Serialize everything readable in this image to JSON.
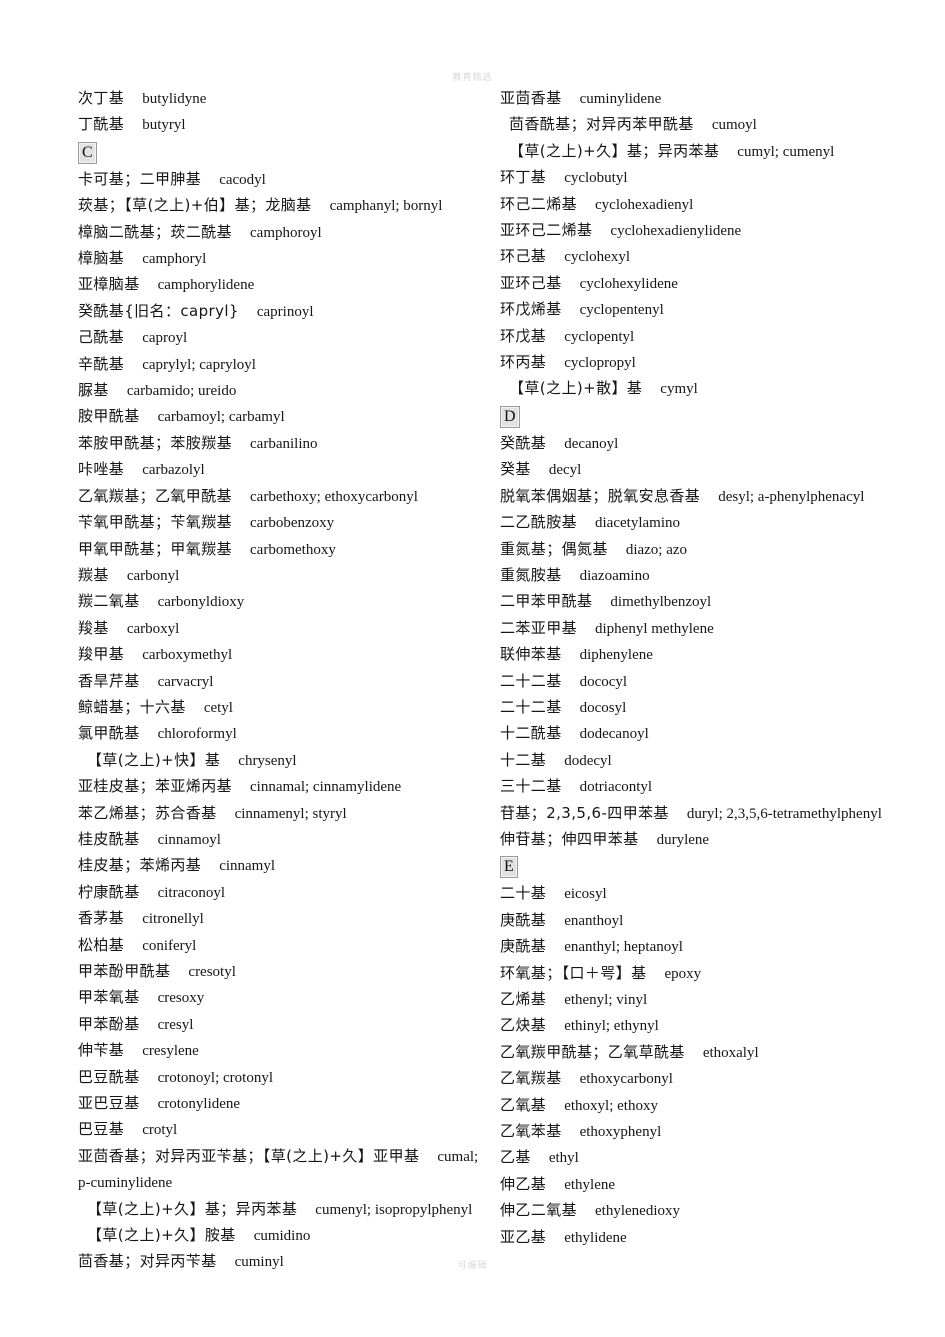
{
  "watermarks": {
    "top": "教育精选",
    "bottom": "可编辑"
  },
  "left_column": [
    {
      "kind": "entry",
      "cn": "次丁基",
      "en": "butylidyne"
    },
    {
      "kind": "entry",
      "cn": "丁酰基",
      "en": "butyryl"
    },
    {
      "kind": "section",
      "letter": "C"
    },
    {
      "kind": "entry",
      "cn": "卡可基；二甲胂基",
      "en": "cacodyl"
    },
    {
      "kind": "entry",
      "cn": "莰基；【草(之上)+伯】基；龙脑基",
      "en": "camphanyl; bornyl"
    },
    {
      "kind": "entry",
      "cn": "樟脑二酰基；莰二酰基",
      "en": "camphoroyl"
    },
    {
      "kind": "entry",
      "cn": "樟脑基",
      "en": "camphoryl"
    },
    {
      "kind": "entry",
      "cn": "亚樟脑基",
      "en": "camphorylidene"
    },
    {
      "kind": "entry",
      "cn": "癸酰基{旧名：capryl}",
      "en": "caprinoyl"
    },
    {
      "kind": "entry",
      "cn": "己酰基",
      "en": "caproyl"
    },
    {
      "kind": "entry",
      "cn": "辛酰基",
      "en": "caprylyl; capryloyl"
    },
    {
      "kind": "entry",
      "cn": "脲基",
      "en": "carbamido; ureido"
    },
    {
      "kind": "entry",
      "cn": "胺甲酰基",
      "en": "carbamoyl; carbamyl"
    },
    {
      "kind": "entry",
      "cn": "苯胺甲酰基；苯胺羰基",
      "en": "carbanilino"
    },
    {
      "kind": "entry",
      "cn": "咔唑基",
      "en": "carbazolyl"
    },
    {
      "kind": "entry",
      "cn": "乙氧羰基；乙氧甲酰基",
      "en": "carbethoxy; ethoxycarbonyl"
    },
    {
      "kind": "entry",
      "cn": "苄氧甲酰基；苄氧羰基",
      "en": "carbobenzoxy"
    },
    {
      "kind": "entry",
      "cn": "甲氧甲酰基；甲氧羰基",
      "en": "carbomethoxy"
    },
    {
      "kind": "entry",
      "cn": "羰基",
      "en": "carbonyl"
    },
    {
      "kind": "entry",
      "cn": "羰二氧基",
      "en": "carbonyldioxy"
    },
    {
      "kind": "entry",
      "cn": "羧基",
      "en": "carboxyl"
    },
    {
      "kind": "entry",
      "cn": "羧甲基",
      "en": "carboxymethyl"
    },
    {
      "kind": "entry",
      "cn": "香旱芹基",
      "en": "carvacryl"
    },
    {
      "kind": "entry",
      "cn": "鲸蜡基；十六基",
      "en": "cetyl"
    },
    {
      "kind": "entry",
      "cn": "氯甲酰基",
      "en": "chloroformyl"
    },
    {
      "kind": "entry",
      "cn": "【草(之上)+快】基",
      "en": "chrysenyl",
      "indent": true
    },
    {
      "kind": "entry",
      "cn": "亚桂皮基；苯亚烯丙基",
      "en": "cinnamal; cinnamylidene"
    },
    {
      "kind": "entry",
      "cn": "苯乙烯基；苏合香基",
      "en": "cinnamenyl; styryl"
    },
    {
      "kind": "entry",
      "cn": "桂皮酰基",
      "en": "cinnamoyl"
    },
    {
      "kind": "entry",
      "cn": "桂皮基；苯烯丙基",
      "en": "cinnamyl"
    },
    {
      "kind": "entry",
      "cn": "柠康酰基",
      "en": "citraconoyl"
    },
    {
      "kind": "entry",
      "cn": "香茅基",
      "en": "citronellyl"
    },
    {
      "kind": "entry",
      "cn": "松柏基",
      "en": "coniferyl"
    },
    {
      "kind": "entry",
      "cn": "甲苯酚甲酰基",
      "en": "cresotyl"
    },
    {
      "kind": "entry",
      "cn": "甲苯氧基",
      "en": "cresoxy"
    },
    {
      "kind": "entry",
      "cn": "甲苯酚基",
      "en": "cresyl"
    },
    {
      "kind": "entry",
      "cn": "伸苄基",
      "en": "cresylene"
    },
    {
      "kind": "entry",
      "cn": "巴豆酰基",
      "en": "crotonoyl; crotonyl"
    },
    {
      "kind": "entry",
      "cn": "亚巴豆基",
      "en": "crotonylidene"
    },
    {
      "kind": "entry",
      "cn": "巴豆基",
      "en": "crotyl"
    },
    {
      "kind": "entry",
      "cn": "亚茴香基；对异丙亚苄基；【草(之上)+久】亚甲基",
      "en": "cumal; p-cuminylidene"
    },
    {
      "kind": "entry",
      "cn": "【草(之上)+久】基；异丙苯基",
      "en": "cumenyl; isopropylphenyl",
      "indent": true
    },
    {
      "kind": "entry",
      "cn": "【草(之上)+久】胺基",
      "en": "cumidino",
      "indent": true
    },
    {
      "kind": "entry",
      "cn": "茴香基；对异丙苄基",
      "en": "cuminyl"
    }
  ],
  "right_column": [
    {
      "kind": "entry",
      "cn": "亚茴香基",
      "en": "cuminylidene"
    },
    {
      "kind": "entry",
      "cn": "茴香酰基；对异丙苯甲酰基",
      "en": "cumoyl",
      "indent": true
    },
    {
      "kind": "entry",
      "cn": "【草(之上)+久】基；异丙苯基",
      "en": "cumyl; cumenyl",
      "indent": true
    },
    {
      "kind": "entry",
      "cn": "环丁基",
      "en": "cyclobutyl"
    },
    {
      "kind": "entry",
      "cn": "环己二烯基",
      "en": "cyclohexadienyl"
    },
    {
      "kind": "entry",
      "cn": "亚环己二烯基",
      "en": "cyclohexadienylidene"
    },
    {
      "kind": "entry",
      "cn": "环己基",
      "en": "cyclohexyl"
    },
    {
      "kind": "entry",
      "cn": "亚环己基",
      "en": "cyclohexylidene"
    },
    {
      "kind": "entry",
      "cn": "环戊烯基",
      "en": "cyclopentenyl"
    },
    {
      "kind": "entry",
      "cn": "环戊基",
      "en": "cyclopentyl"
    },
    {
      "kind": "entry",
      "cn": "环丙基",
      "en": "cyclopropyl"
    },
    {
      "kind": "entry",
      "cn": "【草(之上)+散】基",
      "en": "cymyl",
      "indent": true
    },
    {
      "kind": "section",
      "letter": "D"
    },
    {
      "kind": "entry",
      "cn": "癸酰基",
      "en": "decanoyl"
    },
    {
      "kind": "entry",
      "cn": "癸基",
      "en": "decyl"
    },
    {
      "kind": "entry",
      "cn": "脱氧苯偶姻基；脱氧安息香基",
      "en": "desyl; a-phenylphenacyl"
    },
    {
      "kind": "entry",
      "cn": "二乙酰胺基",
      "en": "diacetylamino"
    },
    {
      "kind": "entry",
      "cn": "重氮基；偶氮基",
      "en": "diazo; azo"
    },
    {
      "kind": "entry",
      "cn": "重氮胺基",
      "en": "diazoamino"
    },
    {
      "kind": "entry",
      "cn": "二甲苯甲酰基",
      "en": "dimethylbenzoyl"
    },
    {
      "kind": "entry",
      "cn": "二苯亚甲基",
      "en": "diphenyl methylene"
    },
    {
      "kind": "entry",
      "cn": "联伸苯基",
      "en": "diphenylene"
    },
    {
      "kind": "entry",
      "cn": "二十二基",
      "en": "dococyl"
    },
    {
      "kind": "entry",
      "cn": "二十二基",
      "en": "docosyl"
    },
    {
      "kind": "entry",
      "cn": "十二酰基",
      "en": "dodecanoyl"
    },
    {
      "kind": "entry",
      "cn": "十二基",
      "en": "dodecyl"
    },
    {
      "kind": "entry",
      "cn": "三十二基",
      "en": "dotriacontyl"
    },
    {
      "kind": "entry",
      "cn": "苷基；2,3,5,6-四甲苯基",
      "en": "duryl; 2,3,5,6-tetramethylphenyl"
    },
    {
      "kind": "entry",
      "cn": "伸苷基；伸四甲苯基",
      "en": "durylene"
    },
    {
      "kind": "section",
      "letter": "E"
    },
    {
      "kind": "entry",
      "cn": "二十基",
      "en": "eicosyl"
    },
    {
      "kind": "entry",
      "cn": "庚酰基",
      "en": "enanthoyl"
    },
    {
      "kind": "entry",
      "cn": "庚酰基",
      "en": "enanthyl; heptanoyl"
    },
    {
      "kind": "entry",
      "cn": "环氧基；【口＋咢】基",
      "en": "epoxy"
    },
    {
      "kind": "entry",
      "cn": "乙烯基",
      "en": "ethenyl; vinyl"
    },
    {
      "kind": "entry",
      "cn": "乙炔基",
      "en": "ethinyl; ethynyl"
    },
    {
      "kind": "entry",
      "cn": "乙氧羰甲酰基；乙氧草酰基",
      "en": "ethoxalyl"
    },
    {
      "kind": "entry",
      "cn": "乙氧羰基",
      "en": "ethoxycarbonyl"
    },
    {
      "kind": "entry",
      "cn": "乙氧基",
      "en": "ethoxyl; ethoxy"
    },
    {
      "kind": "entry",
      "cn": "乙氧苯基",
      "en": "ethoxyphenyl"
    },
    {
      "kind": "entry",
      "cn": "乙基",
      "en": "ethyl"
    },
    {
      "kind": "entry",
      "cn": "伸乙基",
      "en": "ethylene"
    },
    {
      "kind": "entry",
      "cn": "伸乙二氧基",
      "en": "ethylenedioxy"
    },
    {
      "kind": "entry",
      "cn": "亚乙基",
      "en": "ethylidene"
    }
  ]
}
